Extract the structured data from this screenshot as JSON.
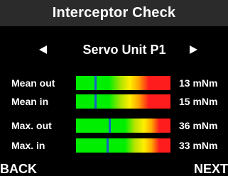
{
  "header": {
    "title": "Interceptor Check"
  },
  "unit_selector": {
    "name": "Servo Unit P1"
  },
  "measurements": [
    {
      "label": "Mean out",
      "value": "13 mNm",
      "marker_fraction": 0.2
    },
    {
      "label": "Mean in",
      "value": "15 mNm",
      "marker_fraction": 0.2
    },
    {
      "label": "Max. out",
      "value": "36 mNm",
      "marker_fraction": 0.35
    },
    {
      "label": "Max. in",
      "value": "33 mNm",
      "marker_fraction": 0.33
    }
  ],
  "footer": {
    "back_label": "BACK",
    "next_label": "NEXT"
  },
  "colors": {
    "background": "#000000",
    "title_bar": "#2b2b2b",
    "text": "#ffffff",
    "bar_green": "#00ee00",
    "bar_yellow": "#ffee00",
    "bar_red": "#ff1c1c",
    "marker": "#1860c8"
  }
}
